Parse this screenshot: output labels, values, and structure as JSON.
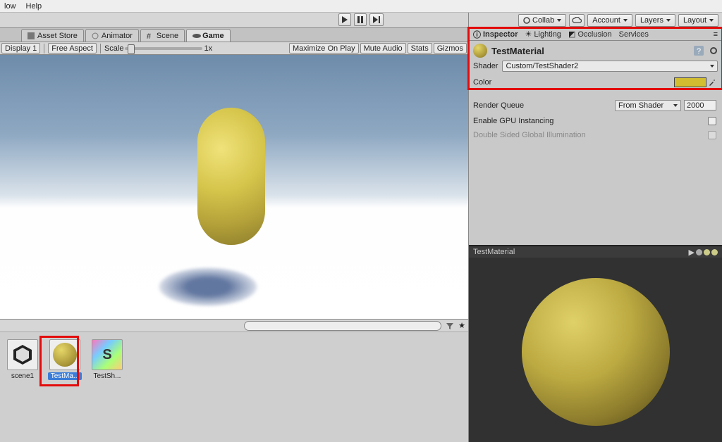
{
  "menu": {
    "items": [
      "low",
      "Help"
    ]
  },
  "playback": {
    "play": "▶",
    "pause": "▮▮",
    "step": "▶|"
  },
  "top_buttons": {
    "collab": "Collab",
    "cloud": "",
    "account": "Account",
    "layers": "Layers",
    "layout": "Layout"
  },
  "left_tabs": [
    {
      "label": "Asset Store"
    },
    {
      "label": "Animator"
    },
    {
      "label": "Scene"
    },
    {
      "label": "Game",
      "active": true
    }
  ],
  "game_toolbar": {
    "display": "Display 1",
    "aspect": "Free Aspect",
    "scale_label": "Scale",
    "scale_value": "1x",
    "maximize": "Maximize On Play",
    "mute": "Mute Audio",
    "stats": "Stats",
    "gizmos": "Gizmos"
  },
  "assets": [
    {
      "name": "scene1",
      "thumb": "unity"
    },
    {
      "name": "TestMa...",
      "thumb": "material",
      "selected": true
    },
    {
      "name": "TestSh...",
      "thumb": "shader"
    }
  ],
  "inspector_tabs": [
    "Inspector",
    "Lighting",
    "Occlusion",
    "Services"
  ],
  "material": {
    "name": "TestMaterial",
    "shader_label": "Shader",
    "shader_value": "Custom/TestShader2",
    "color_label": "Color",
    "color_value": "#d1bd2f",
    "render_queue_label": "Render Queue",
    "render_queue_mode": "From Shader",
    "render_queue_value": "2000",
    "gpu_inst_label": "Enable GPU Instancing",
    "dsgi_label": "Double Sided Global Illumination"
  },
  "preview": {
    "title": "TestMaterial"
  }
}
